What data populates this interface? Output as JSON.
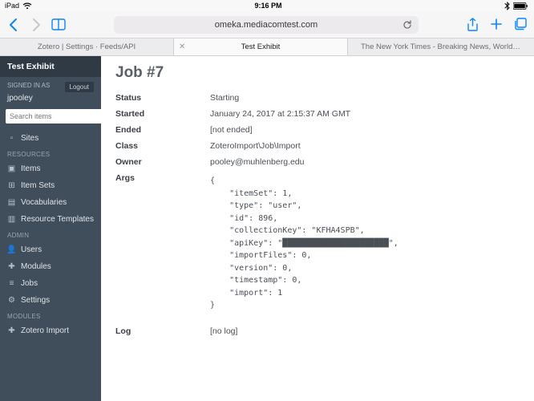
{
  "status_bar": {
    "device": "iPad",
    "time": "9:16 PM",
    "battery_icon": "⚡",
    "bt_icon": "⧈"
  },
  "safari": {
    "url": "omeka.mediacomtest.com",
    "tabs": [
      {
        "label": "Zotero | Settings · Feeds/API",
        "active": false
      },
      {
        "label": "Test Exhibit",
        "active": true
      },
      {
        "label": "The New York Times - Breaking News, World News & Multimedia",
        "active": false
      }
    ]
  },
  "sidebar": {
    "title": "Test Exhibit",
    "signed_in_as": "SIGNED IN AS",
    "user": "jpooley",
    "logout": "Logout",
    "search_placeholder": "Search items",
    "items": [
      {
        "icon": "▫",
        "label": "Sites"
      }
    ],
    "resources_header": "RESOURCES",
    "resources": [
      {
        "icon": "▣",
        "label": "Items"
      },
      {
        "icon": "⊞",
        "label": "Item Sets"
      },
      {
        "icon": "📘",
        "label": "Vocabularies"
      },
      {
        "icon": "📄",
        "label": "Resource Templates"
      }
    ],
    "admin_header": "ADMIN",
    "admin": [
      {
        "icon": "👤",
        "label": "Users"
      },
      {
        "icon": "✚",
        "label": "Modules"
      },
      {
        "icon": "≡",
        "label": "Jobs"
      },
      {
        "icon": "⚙",
        "label": "Settings"
      }
    ],
    "modules_header": "MODULES",
    "modules": [
      {
        "icon": "✚",
        "label": "Zotero Import"
      }
    ]
  },
  "main": {
    "title": "Job #7",
    "rows": {
      "status_l": "Status",
      "status_v": "Starting",
      "started_l": "Started",
      "started_v": "January 24, 2017 at 2:15:37 AM GMT",
      "ended_l": "Ended",
      "ended_v": "[not ended]",
      "class_l": "Class",
      "class_v": "ZoteroImport\\Job\\Import",
      "owner_l": "Owner",
      "owner_v": "pooley@muhlenberg.edu",
      "args_l": "Args",
      "log_l": "Log",
      "log_v": "[no log]"
    },
    "args_code": "{\n    \"itemSet\": 1,\n    \"type\": \"user\",\n    \"id\": 896,\n    \"collectionKey\": \"KFHA4SPB\",\n    \"apiKey\": \"██████████████████████\",\n    \"importFiles\": 0,\n    \"version\": 0,\n    \"timestamp\": 0,\n    \"import\": 1\n}"
  }
}
